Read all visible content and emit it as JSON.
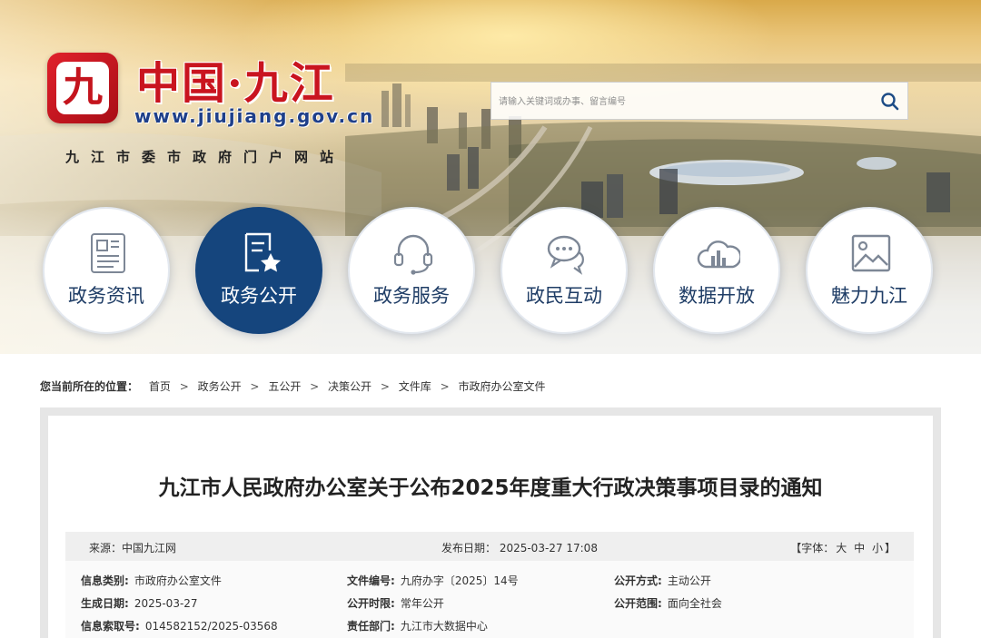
{
  "header": {
    "logo_glyph": "九",
    "site_name": "中国·九江",
    "site_url": "www.jiujiang.gov.cn",
    "subtitle": "九江市委市政府门户网站"
  },
  "search": {
    "placeholder": "请输入关键词或办事、留言编号",
    "icon": "search-icon"
  },
  "nav": {
    "items": [
      {
        "label": "政务资讯",
        "icon": "newspaper-icon",
        "active": false
      },
      {
        "label": "政务公开",
        "icon": "document-star-icon",
        "active": true
      },
      {
        "label": "政务服务",
        "icon": "headset-icon",
        "active": false
      },
      {
        "label": "政民互动",
        "icon": "chat-bubbles-icon",
        "active": false
      },
      {
        "label": "数据开放",
        "icon": "cloud-chart-icon",
        "active": false
      },
      {
        "label": "魅力九江",
        "icon": "picture-icon",
        "active": false
      }
    ]
  },
  "breadcrumb": {
    "prefix": "您当前所在的位置：",
    "items": [
      "首页",
      "政务公开",
      "五公开",
      "决策公开",
      "文件库",
      "市政府办公室文件"
    ],
    "separator": ">"
  },
  "article": {
    "title": "九江市人民政府办公室关于公布2025年度重大行政决策事项目录的通知",
    "source": "来源：中国九江网",
    "publish_date": "发布日期：  2025-03-27 17:08",
    "font_size": {
      "prefix": "【字体：",
      "large": "大",
      "medium": "中",
      "small": "小",
      "suffix": "】"
    },
    "info": {
      "category_label": "信息类别:",
      "category_value": "市政府办公室文件",
      "doc_no_label": "文件编号:",
      "doc_no_value": "九府办字〔2025〕14号",
      "public_mode_label": "公开方式:",
      "public_mode_value": "主动公开",
      "gen_date_label": "生成日期:",
      "gen_date_value": "2025-03-27",
      "period_label": "公开时限:",
      "period_value": "常年公开",
      "scope_label": "公开范围:",
      "scope_value": "面向全社会",
      "index_label": "信息索取号:",
      "index_value": "014582152/2025-03568",
      "dept_label": "责任部门:",
      "dept_value": "九江市大数据中心"
    }
  },
  "colors": {
    "brand_red": "#c9141f",
    "nav_active": "#15457d",
    "nav_text": "#1f3d66"
  }
}
